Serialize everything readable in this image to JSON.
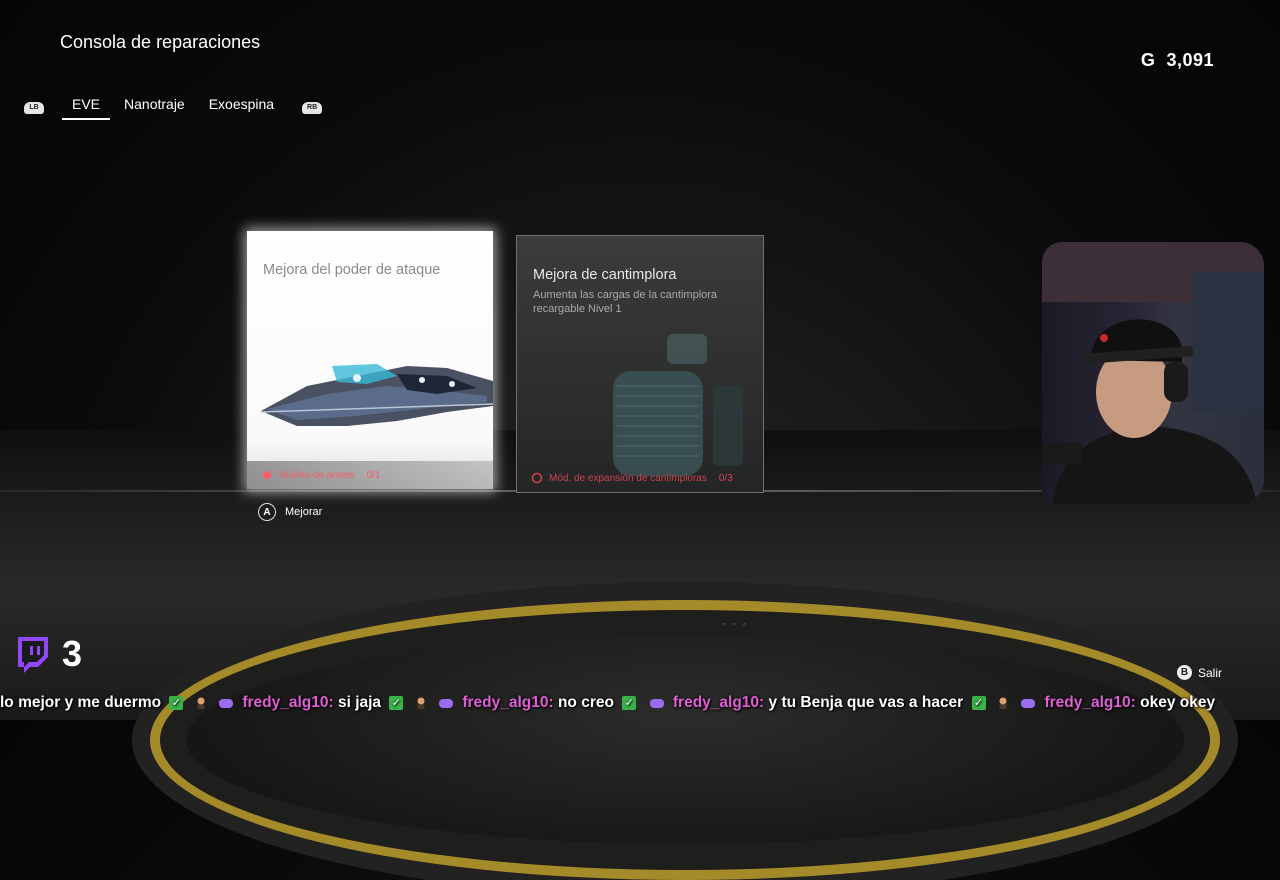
{
  "header": {
    "title": "Consola de reparaciones",
    "currency_symbol": "G",
    "currency_value": "3,091"
  },
  "tabs": {
    "left_bumper": "LB",
    "right_bumper": "RB",
    "items": [
      {
        "label": "EVE",
        "active": true
      },
      {
        "label": "Nanotraje",
        "active": false
      },
      {
        "label": "Exoespina",
        "active": false
      }
    ]
  },
  "cards": [
    {
      "title": "Mejora del poder de ataque",
      "requirement": "Núcleo de armas",
      "count": "0/1",
      "selected": true
    },
    {
      "title": "Mejora de cantimplora",
      "description": "Aumenta las cargas de la cantimplora recargable Nivel 1",
      "requirement": "Mód. de expansión de cantimploras",
      "count": "0/3",
      "selected": false
    }
  ],
  "prompts": {
    "confirm_button": "A",
    "confirm_label": "Mejorar",
    "back_button": "B",
    "back_label": "Salir"
  },
  "stream": {
    "viewer_count": "3",
    "chat_ticker": [
      {
        "text": "lo mejor y me duermo"
      },
      {
        "user": "fredy_alg10:",
        "text": "si jaja"
      },
      {
        "user": "fredy_alg10:",
        "text": "no creo"
      },
      {
        "user": "fredy_alg10:",
        "text": "y tu Benja que vas a hacer"
      },
      {
        "user": "fredy_alg10:",
        "text": "okey okey"
      }
    ]
  },
  "colors": {
    "requirement_red": "#ff5a66",
    "chat_username": "#e05fd6",
    "twitch_purple": "#9146ff",
    "platform_gold": "#a58a2a"
  }
}
